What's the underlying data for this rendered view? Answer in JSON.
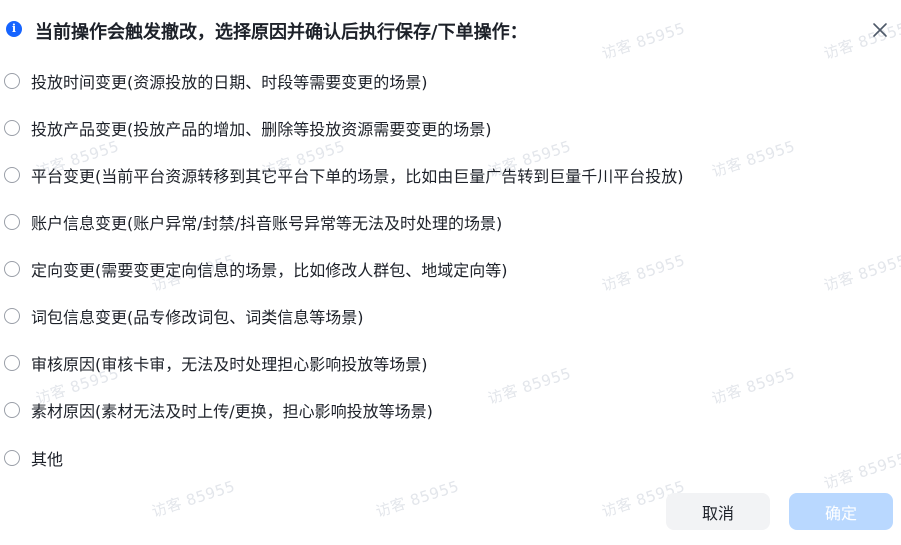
{
  "dialog": {
    "title": "当前操作会触发撤改，选择原因并确认后执行保存/下单操作：",
    "info_icon": "info-icon",
    "close_icon": "close-icon"
  },
  "options": [
    {
      "label": "投放时间变更(资源投放的日期、时段等需要变更的场景)",
      "selected": false
    },
    {
      "label": "投放产品变更(投放产品的增加、删除等投放资源需要变更的场景)",
      "selected": false
    },
    {
      "label": "平台变更(当前平台资源转移到其它平台下单的场景，比如由巨量广告转到巨量千川平台投放)",
      "selected": false
    },
    {
      "label": "账户信息变更(账户异常/封禁/抖音账号异常等无法及时处理的场景)",
      "selected": false
    },
    {
      "label": "定向变更(需要变更定向信息的场景，比如修改人群包、地域定向等)",
      "selected": false
    },
    {
      "label": "词包信息变更(品专修改词包、词类信息等场景)",
      "selected": false
    },
    {
      "label": "审核原因(审核卡审，无法及时处理担心影响投放等场景)",
      "selected": false
    },
    {
      "label": "素材原因(素材无法及时上传/更换，担心影响投放等场景)",
      "selected": false
    },
    {
      "label": "其他",
      "selected": false
    }
  ],
  "footer": {
    "cancel_label": "取消",
    "confirm_label": "确定",
    "confirm_disabled": true
  },
  "watermark": {
    "text": "访客 85955"
  },
  "colors": {
    "accent": "#1664ff",
    "confirm_disabled_bg": "#b9d8ff",
    "cancel_bg": "#f2f3f5",
    "text": "#1d2129",
    "watermark": "#e3e6eb"
  }
}
